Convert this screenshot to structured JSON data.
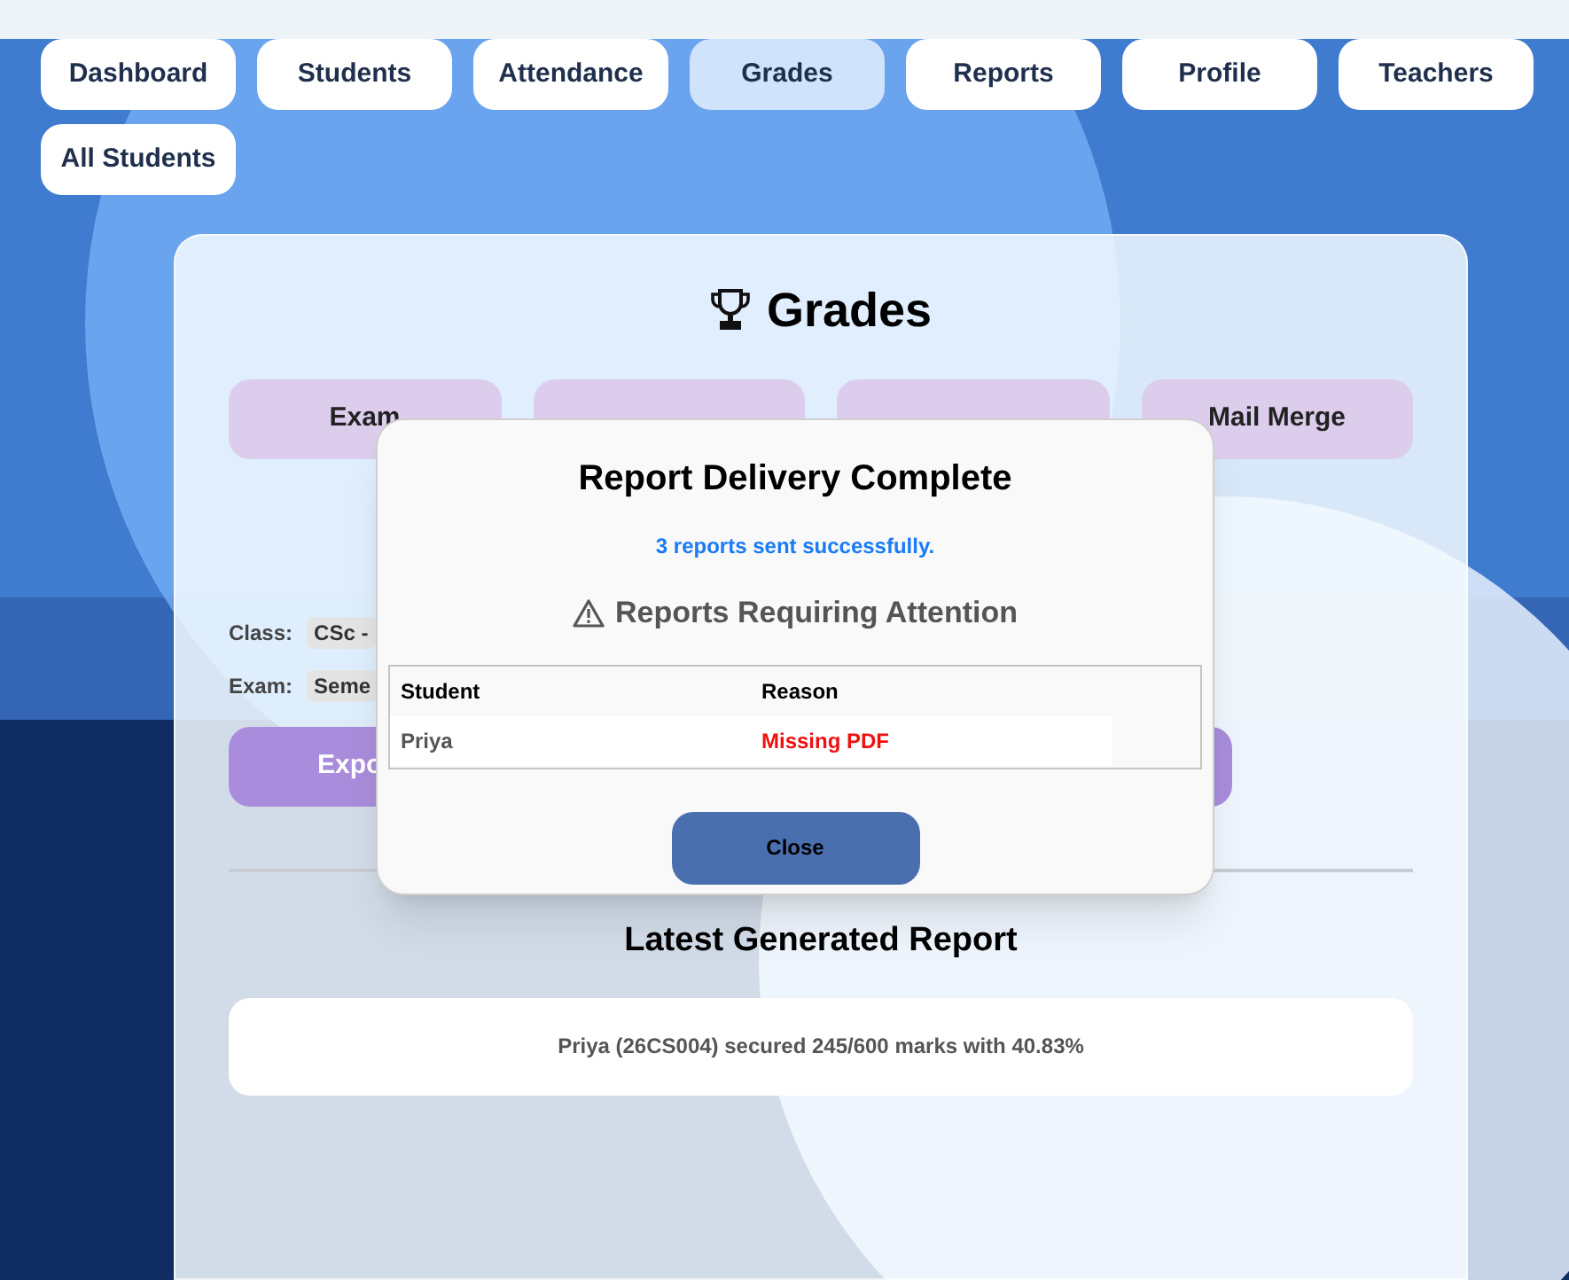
{
  "nav": [
    {
      "label": "Dashboard",
      "selected": false
    },
    {
      "label": "Students",
      "selected": false
    },
    {
      "label": "Attendance",
      "selected": false
    },
    {
      "label": "Grades",
      "selected": true
    },
    {
      "label": "Reports",
      "selected": false
    },
    {
      "label": "Profile",
      "selected": false
    },
    {
      "label": "Teachers",
      "selected": false
    },
    {
      "label": "All Students",
      "selected": false
    }
  ],
  "card": {
    "title": "Grades",
    "tabs": [
      {
        "kind": "labeled",
        "label": "Exam"
      },
      {
        "kind": "covered"
      },
      {
        "kind": "covered"
      },
      {
        "kind": "labeled",
        "label": "Mail Merge"
      }
    ],
    "fields": [
      {
        "label": "Class:",
        "value": "CSc -"
      },
      {
        "label": "Exam:",
        "value": "Seme"
      }
    ],
    "export_button": "Expo",
    "latest_title": "Latest Generated Report",
    "latest_report": "Priya (26CS004) secured 245/600 marks with 40.83%"
  },
  "dialog": {
    "title": "Report Delivery Complete",
    "message": "3 reports sent successfully.",
    "warning_title": "Reports Requiring Attention",
    "columns": [
      "Student",
      "Reason"
    ],
    "rows": [
      {
        "student": "Priya",
        "reason": "Missing PDF"
      }
    ],
    "close_button": "Close"
  }
}
